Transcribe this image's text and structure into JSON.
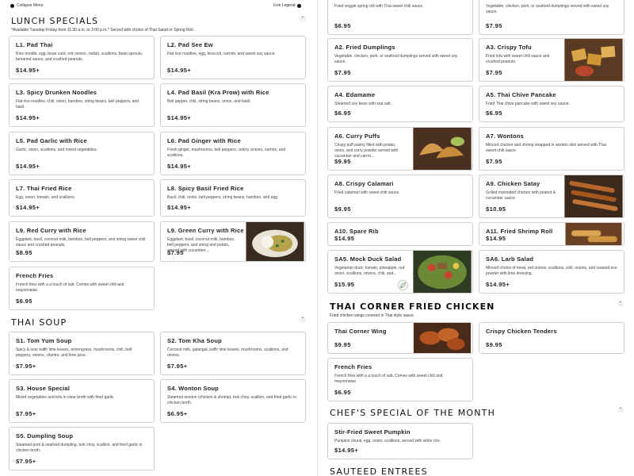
{
  "topbar": {
    "collapse_label": "Collapse Menu",
    "icon_legend": "Icon Legend"
  },
  "lunch": {
    "title": "LUNCH SPECIALS",
    "note": "*Available Tuesday-Friday from 11:30 a.m. to 3:00 p.m.* Served with choice of Thai Salad or Spring Roll..",
    "items": [
      {
        "name": "L1. Pad Thai",
        "desc": "Rice noodle, egg, bean curd, red onions, radish, scallions, bean sprouts, tamarind sauce, and crushed peanuts.",
        "price": "$14.95+"
      },
      {
        "name": "L2. Pad See Ew",
        "desc": "Flat rice noodles, egg, broccoli, carrots, and sweet soy sauce.",
        "price": "$14.95+"
      },
      {
        "name": "L3. Spicy Drunken Noodles",
        "desc": "Flat rice noodles, chili, onion, bamboo, string beans, bell peppers, and basil.",
        "price": "$14.95+"
      },
      {
        "name": "L4. Pad Basil (Kra Prow) with Rice",
        "desc": "Bell pepper, chili, string beans, onion, and basil.",
        "price": "$14.95+"
      },
      {
        "name": "L5. Pad Garlic with Rice",
        "desc": "Garlic, onion, scallions, and mixed vegetables.",
        "price": "$14.95+"
      },
      {
        "name": "L6. Pad Ginger with Rice",
        "desc": "Fresh ginger, mushrooms, bell peppers, celery, onions, carrots, and scallions.",
        "price": "$14.95+"
      },
      {
        "name": "L7. Thai Fried Rice",
        "desc": "Egg, onion, tomato, and scallions.",
        "price": "$14.95+"
      },
      {
        "name": "L8. Spicy Basil Fried Rice",
        "desc": "Basil, chili, onion, bell peppers, string beans, bamboo, and egg.",
        "price": "$14.95+"
      },
      {
        "name": "L9. Red Curry with Rice",
        "desc": "Eggplant, basil, coconut milk, bamboo, bell peppers, and string sweet chili sauce and crushed peanuts.",
        "price": "$8.95"
      },
      {
        "name": "L9. Green Curry with Rice",
        "desc": "Eggplant, basil, coconut milk, bamboo, bell peppers, and string and potato, served with cucumber...",
        "price": "$7.95"
      },
      {
        "name": "French Fries",
        "desc": "French fries with a a touch of salt. Comes with sweet chili and mayonnaise.",
        "price": "$6.95"
      }
    ]
  },
  "soup": {
    "title": "THAI SOUP",
    "items": [
      {
        "name": "S1. Tom Yum Soup",
        "desc": "Spicy & sour kaffir lime leaves, lemongrass, mushrooms, chili, bell peppers, onions, cilantro, and lime juice.",
        "price": "$7.95+"
      },
      {
        "name": "S2. Tom Kha Soup",
        "desc": "Coconut milk, galangal, kaffir lime leaves, mushrooms, scallions, and onions.",
        "price": "$7.95+"
      },
      {
        "name": "S3. House Special",
        "desc": "Mixed vegetables and tofu in clear broth with fried garlic.",
        "price": "$7.95+"
      },
      {
        "name": "S4. Wonton Soup",
        "desc": "Steamed wonton (chicken & shrimp), bok choy, scallion, and fried garlic in chicken broth.",
        "price": "$6.95+"
      },
      {
        "name": "S5. Dumpling Soup",
        "desc": "Steamed pork & seafood dumpling, bok choy, scallion, and fried garlic in chicken broth.",
        "price": "$7.95+"
      }
    ]
  },
  "appetizers": {
    "items": [
      {
        "name": "",
        "desc": "Fried veggie spring roll with Thai sweet chili sauce.",
        "price": "$6.95"
      },
      {
        "name": "",
        "desc": "Vegetable, chicken, pork, or seafood dumplings served with sweet soy sauce.",
        "price": "$7.95"
      },
      {
        "name": "A2. Fried Dumplings",
        "desc": "Vegetable, chicken, pork, or seafood dumplings served with sweet soy sauce.",
        "price": "$7.95"
      },
      {
        "name": "A3. Crispy Tofu",
        "desc": "Fried tofu with sweet chili sauce and crushed peanuts.",
        "price": "$7.95"
      },
      {
        "name": "A4. Edamame",
        "desc": "Steamed soy bean with sea salt.",
        "price": "$6.95"
      },
      {
        "name": "A5. Thai Chive Pancake",
        "desc": "Fried Thai chive pancake with sweet soy sauce.",
        "price": "$6.95"
      },
      {
        "name": "A6. Curry Puffs",
        "desc": "Crispy puff pastry filled with potato, onion, and curry powder served with cucumber and carrot...",
        "price": "$9.95"
      },
      {
        "name": "A7. Wontons",
        "desc": "Minced chicken and shrimp wrapped in wonton skin served with Thai sweet chili sauce.",
        "price": "$7.95"
      },
      {
        "name": "A8. Crispy Calamari",
        "desc": "Fried calamari with sweet chili sauce.",
        "price": "$9.95"
      },
      {
        "name": "A9. Chicken Satay",
        "desc": "Grilled marinated chicken with peanut & cucumber sauce.",
        "price": "$10.95"
      },
      {
        "name": "A10. Spare Rib",
        "desc": "",
        "price": "$14.95"
      },
      {
        "name": "A11. Fried Shrimp Roll",
        "desc": "",
        "price": "$14.95"
      },
      {
        "name": "SA5. Mock Duck Salad",
        "desc": "Vegetarian duck, tomato, pineapple, red onion, scallions, onions, chili, and...",
        "price": "$15.95"
      },
      {
        "name": "SA6. Larb Salad",
        "desc": "Minced choice of meat, red onions, scallions, chili, onions, and roasted rice powder with lime dressing.",
        "price": "$14.95+"
      }
    ]
  },
  "fried_chicken": {
    "title": "THAI CORNER FRIED CHICKEN",
    "note": "Fried chicken wings covered in Thai style sauce.",
    "items": [
      {
        "name": "Thai Corner Wing",
        "desc": "",
        "price": "$9.95"
      },
      {
        "name": "Crispy Chicken Tenders",
        "desc": "",
        "price": "$9.95"
      },
      {
        "name": "French Fries",
        "desc": "French fries with a a touch of salt. Comes with sweet chili and mayonnaise.",
        "price": "$6.95"
      }
    ]
  },
  "chef": {
    "title": "CHEF'S SPECIAL OF THE MONTH",
    "items": [
      {
        "name": "Stir-Fried Sweet Pumpkin",
        "desc": "Pumpkin chunk, egg, onion, scallions, served with white rice.",
        "price": "$14.95+"
      }
    ]
  },
  "sauteed": {
    "title": "SAUTEED ENTREES"
  },
  "colors": {
    "border": "#cfcfcf",
    "text": "#222222",
    "divider": "#e3e3e3"
  },
  "icons": {
    "collapse": "dot-icon",
    "legend": "dot-icon",
    "chevron": "chevron-up-icon",
    "vegetarian": "leaf-icon"
  }
}
